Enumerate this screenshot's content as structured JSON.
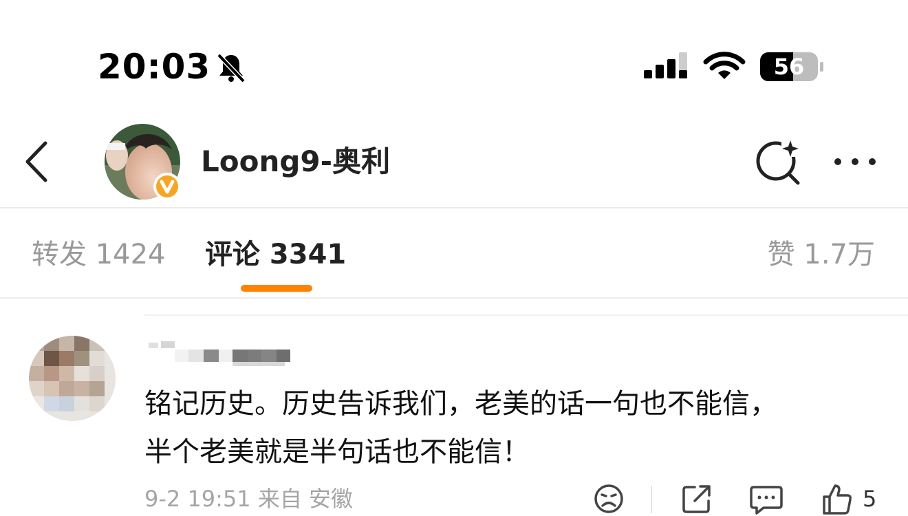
{
  "status_bar": {
    "time": "20:03",
    "battery": "56",
    "icons": [
      "bell-muted-icon",
      "signal-icon",
      "wifi-icon",
      "battery-icon"
    ]
  },
  "header": {
    "username": "Loong9-奥利",
    "verified_badge": "V",
    "icons": [
      "back-icon",
      "ai-search-icon",
      "more-icon"
    ]
  },
  "tabs": [
    {
      "label": "转发 1424",
      "active": false
    },
    {
      "label": "评论 3341",
      "active": true
    },
    {
      "label": "赞 1.7万",
      "active": false
    }
  ],
  "comment": {
    "text_line1": "铭记历史。历史告诉我们，老美的话一句也不能信，",
    "text_line2": "半个老美就是半句话也不能信！",
    "meta": "9-2 19:51 来自 安徽",
    "like_count": "5",
    "icons": [
      "sad-face-icon",
      "share-icon",
      "comment-icon",
      "thumbs-up-icon"
    ]
  },
  "colors": {
    "accent": "#ff8200",
    "muted_text": "#999999",
    "badge": "#f5a623"
  }
}
